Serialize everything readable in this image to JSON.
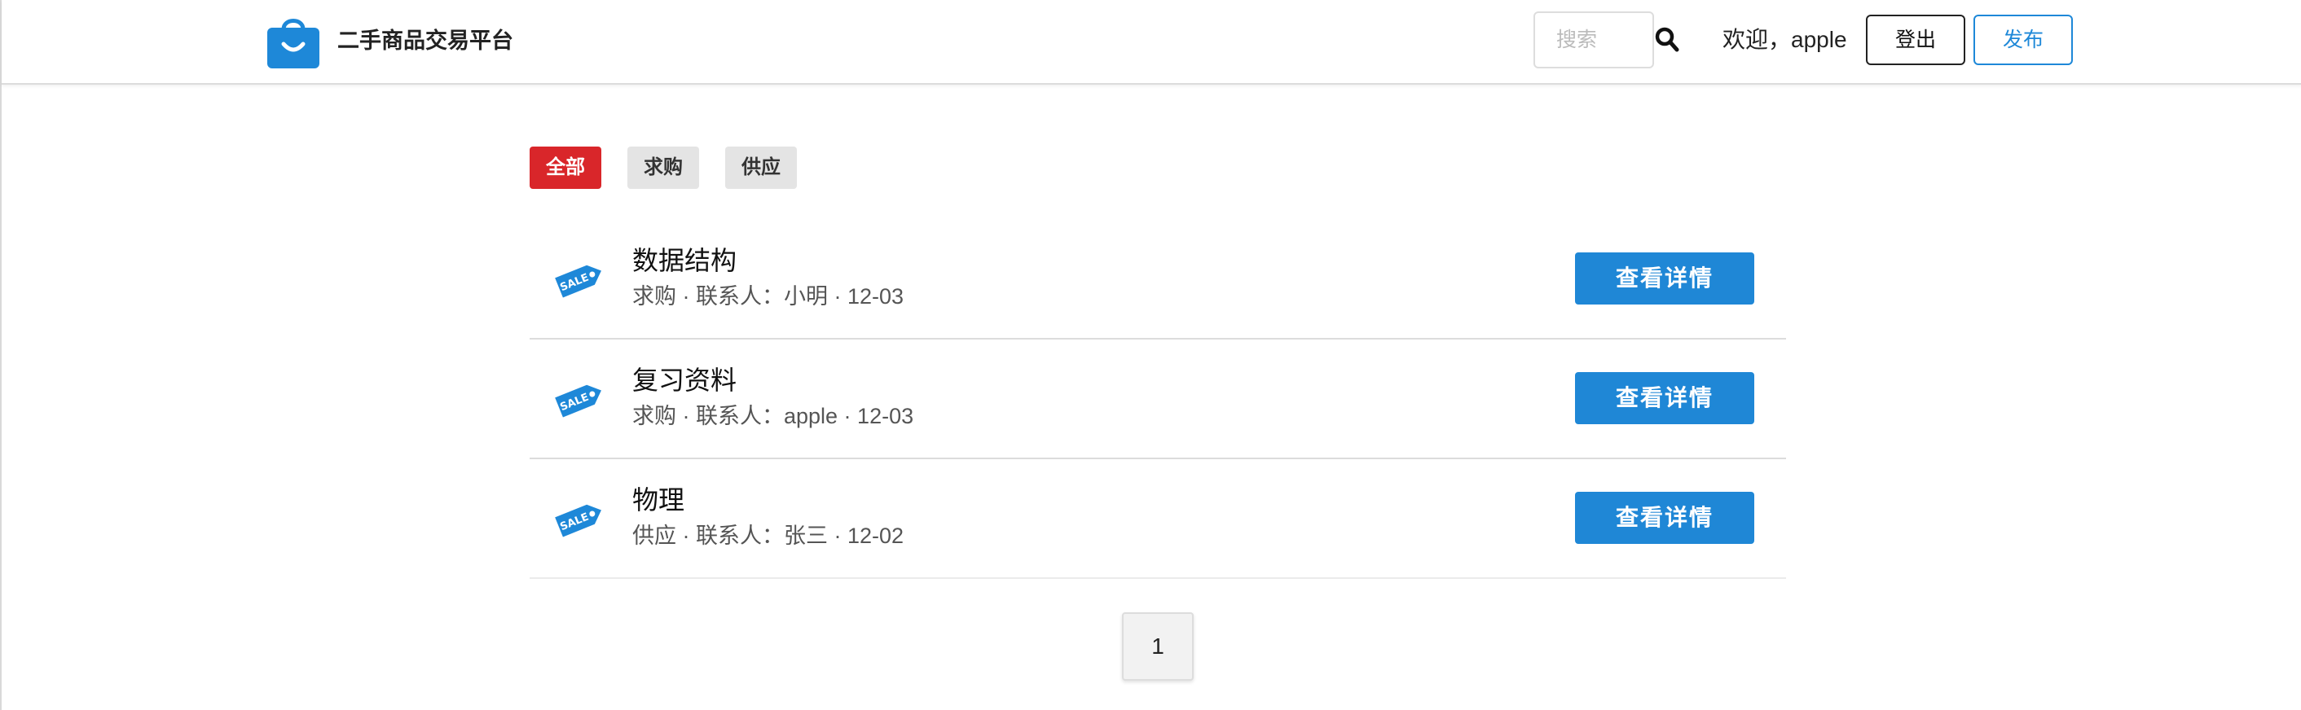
{
  "header": {
    "site_title": "二手商品交易平台",
    "search_placeholder": "搜索",
    "welcome_text": "欢迎，apple",
    "logout_label": "登出",
    "publish_label": "发布"
  },
  "filters": {
    "tabs": [
      {
        "label": "全部",
        "active": true
      },
      {
        "label": "求购",
        "active": false
      },
      {
        "label": "供应",
        "active": false
      }
    ]
  },
  "items": [
    {
      "title": "数据结构",
      "meta": "求购 · 联系人：小明 · 12-03",
      "button_label": "查看详情"
    },
    {
      "title": "复习资料",
      "meta": "求购 · 联系人：apple · 12-03",
      "button_label": "查看详情"
    },
    {
      "title": "物理",
      "meta": "供应 · 联系人：张三 · 12-02",
      "button_label": "查看详情"
    }
  ],
  "pagination": {
    "current_page": "1"
  },
  "icons": {
    "logo": "shopping-bag-icon",
    "search": "search-icon",
    "item": "sale-tag-icon"
  },
  "colors": {
    "primary": "#1f87d6",
    "active_tab": "#d9262a",
    "inactive_tab": "#e4e4e4"
  }
}
